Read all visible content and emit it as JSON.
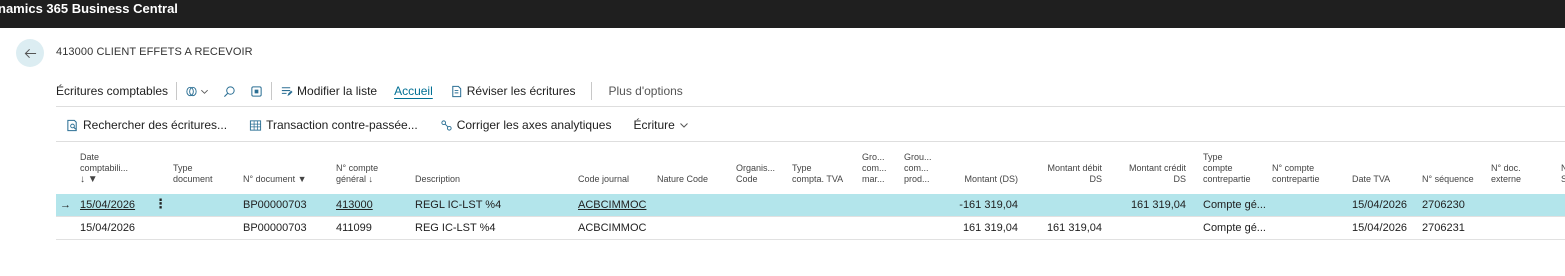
{
  "app": {
    "title": "namics 365 Business Central"
  },
  "page": {
    "title": "413000 CLIENT EFFETS A RECEVOIR"
  },
  "actions": {
    "ecritures_comptables": "Écritures comptables",
    "modifier_liste": "Modifier la liste",
    "accueil": "Accueil",
    "reviser": "Réviser les écritures",
    "plus_options": "Plus d'options"
  },
  "actions2": {
    "rechercher": "Rechercher des écritures...",
    "transaction": "Transaction contre-passée...",
    "corriger": "Corriger les axes analytiques",
    "ecriture": "Écriture"
  },
  "columns": {
    "date_l1": "Date",
    "date_l2": "comptabili...",
    "type_doc_l1": "Type",
    "type_doc_l2": "document",
    "no_document": "N° document",
    "no_compte_l1": "N° compte",
    "no_compte_l2": "général",
    "description": "Description",
    "code_journal": "Code journal",
    "nature_code": "Nature Code",
    "organis_l1": "Organis...",
    "organis_l2": "Code",
    "type_tva_l1": "Type",
    "type_tva_l2": "compta. TVA",
    "gro1_l1": "Gro...",
    "gro1_l2": "com...",
    "gro1_l3": "mar...",
    "gro2_l1": "Grou...",
    "gro2_l2": "com...",
    "gro2_l3": "prod...",
    "montant": "Montant (DS)",
    "montant_debit_l1": "Montant débit",
    "montant_debit_l2": "DS",
    "montant_credit_l1": "Montant crédit",
    "montant_credit_l2": "DS",
    "type_cp_l1": "Type",
    "type_cp_l2": "compte",
    "type_cp_l3": "contrepartie",
    "no_cp_l1": "N° compte",
    "no_cp_l2": "contrepartie",
    "date_tva": "Date TVA",
    "no_sequence": "N° séquence",
    "no_doc_ext_l1": "N° doc.",
    "no_doc_ext_l2": "externe",
    "next_l1": "N",
    "next_l2": "S"
  },
  "rows": [
    {
      "date": "15/04/2026",
      "type_doc": "",
      "no_document": "BP00000703",
      "no_compte": "413000",
      "description": "REGL IC-LST %4",
      "code_journal": "ACBCIMMOC",
      "montant": "-161 319,04",
      "montant_debit": "",
      "montant_credit": "161 319,04",
      "type_cp": "Compte gé...",
      "date_tva": "15/04/2026",
      "no_sequence": "2706230"
    },
    {
      "date": "15/04/2026",
      "type_doc": "",
      "no_document": "BP00000703",
      "no_compte": "411099",
      "description": "REG IC-LST %4",
      "code_journal": "ACBCIMMOC",
      "montant": "161 319,04",
      "montant_debit": "161 319,04",
      "montant_credit": "",
      "type_cp": "Compte gé...",
      "date_tva": "15/04/2026",
      "no_sequence": "2706231"
    }
  ],
  "colors": {
    "accent": "#006f94",
    "selected_row": "#b3e5eb",
    "topbar": "#1f1f1f"
  }
}
